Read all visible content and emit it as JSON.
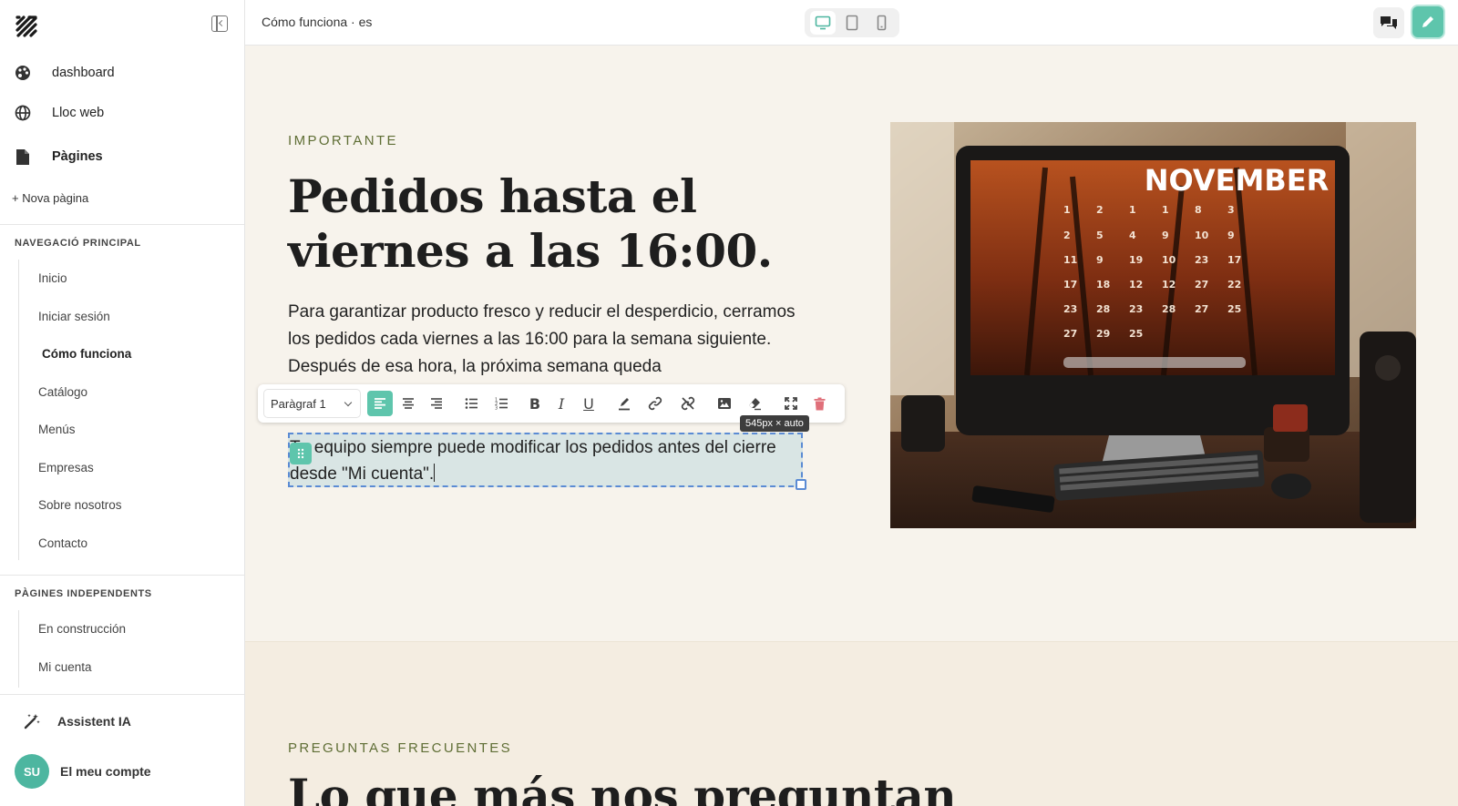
{
  "sidebar": {
    "main": [
      {
        "label": "dashboard",
        "icon": "palette-icon"
      },
      {
        "label": "Lloc web",
        "icon": "globe-icon"
      },
      {
        "label": "Pàgines",
        "icon": "file-icon"
      }
    ],
    "new_page": "+ Nova pàgina",
    "nav_section": {
      "title": "NAVEGACIÓ PRINCIPAL",
      "items": [
        "Inicio",
        "Iniciar sesión",
        "Cómo funciona",
        "Catálogo",
        "Menús",
        "Empresas",
        "Sobre nosotros",
        "Contacto"
      ],
      "active": "Cómo funciona"
    },
    "independent_section": {
      "title": "PÀGINES INDEPENDENTS",
      "items": [
        "En construcción",
        "Mi cuenta"
      ]
    },
    "assistant": "Assistent IA",
    "account": {
      "initials": "SU",
      "label": "El meu compte"
    }
  },
  "topbar": {
    "page_name": "Cómo funciona · es",
    "devices": [
      "desktop-icon",
      "tablet-icon",
      "mobile-icon"
    ],
    "active_device": "desktop"
  },
  "content": {
    "eyebrow": "IMPORTANTE",
    "headline": "Pedidos hasta el viernes a las 16:00.",
    "paragraph": "Para garantizar producto fresco y reducir el desperdicio, cerramos los pedidos cada viernes a las 16:00 para la semana siguiente. Después de esa hora, la próxima semana queda",
    "edited_paragraph": "Tu equipo siempre puede modificar los pedidos antes del cierre desde \"Mi cuenta\".",
    "image_calendar_text": "NOVEMBER"
  },
  "toolbar": {
    "block_type": "Paràgraf 1",
    "size_tip": "545px × auto"
  },
  "faq": {
    "eyebrow": "PREGUNTAS FRECUENTES",
    "title": "Lo que más nos preguntan"
  },
  "colors": {
    "accent": "#5ec5ac",
    "olive": "#5f6e35",
    "canvas_bg": "#f7f3ec",
    "delete": "#e0707a"
  }
}
